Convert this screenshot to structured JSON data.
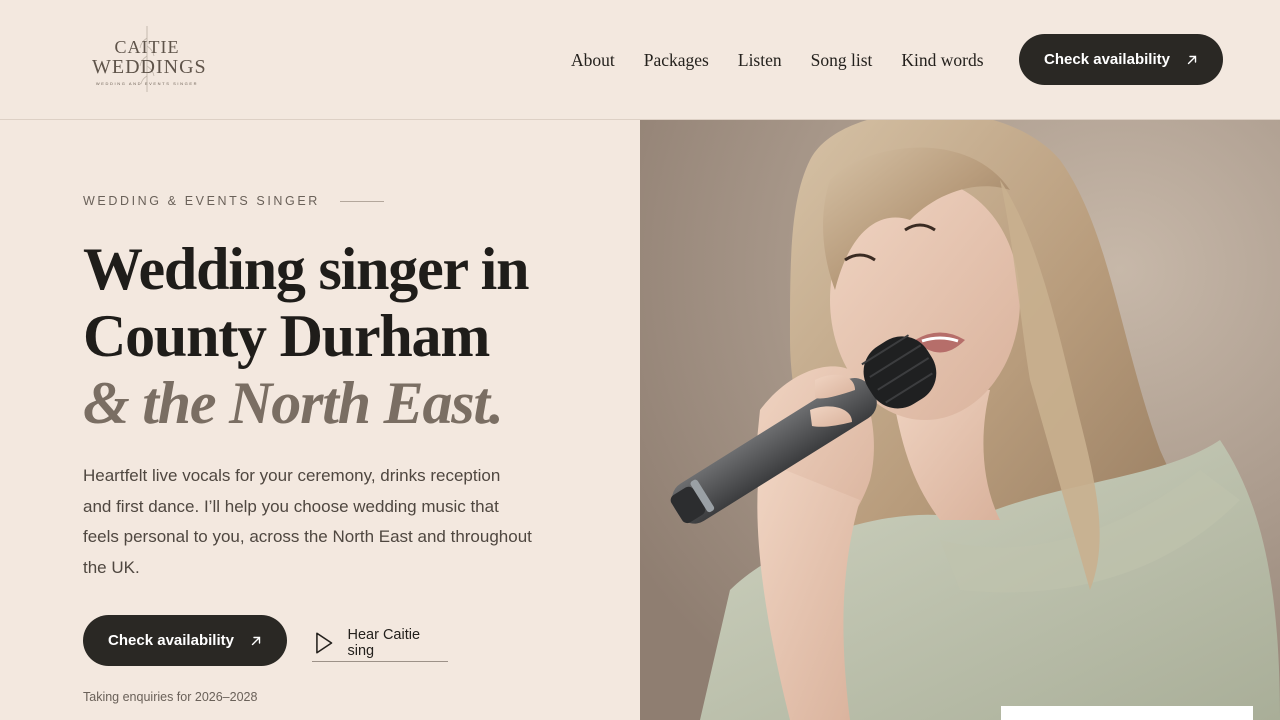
{
  "brand": {
    "line1": "CAITIE",
    "line2": "WEDDINGS",
    "tagline": "WEDDING AND EVENTS SINGER"
  },
  "nav": {
    "items": [
      "About",
      "Packages",
      "Listen",
      "Song list",
      "Kind words"
    ],
    "cta_label": "Check availability"
  },
  "hero": {
    "eyebrow": "WEDDING & EVENTS SINGER",
    "headline_line1": "Wedding singer in",
    "headline_line2": "County Durham",
    "headline_line3": "& the North East.",
    "lede": "Heartfelt live vocals for your ceremony, drinks reception and first dance. I’ll help you choose wedding music that feels personal to you, across the North East and throughout the UK.",
    "cta_label": "Check availability",
    "listen_label": "Hear Caitie sing",
    "enquiries": "Taking enquiries for 2026–2028"
  },
  "colors": {
    "background": "#f3e8df",
    "button": "#2a2824",
    "accent_text": "#7a6e63"
  },
  "icons": {
    "cta_arrow": "arrow-up-right-icon",
    "play": "play-icon",
    "logo_sprig": "sprig-icon"
  }
}
